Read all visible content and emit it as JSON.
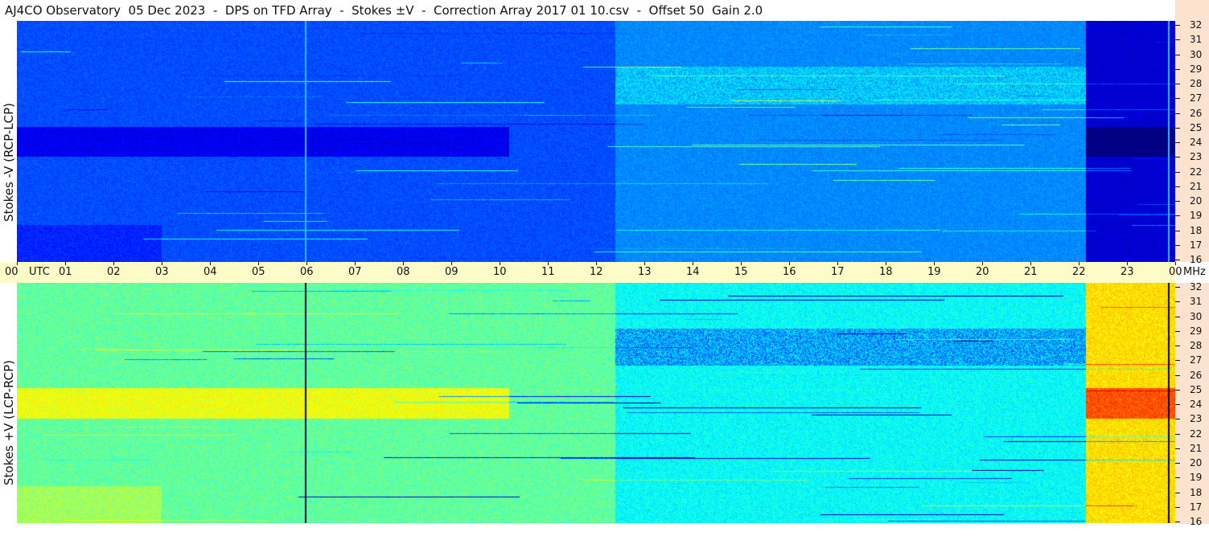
{
  "title": "AJ4CO Observatory  05 Dec 2023  -  DPS on TFD Array  -  Stokes ±V  -  Correction Array 2017 01 10.csv  -  Offset 50  Gain 2.0",
  "panels": {
    "top_label": "Stokes -V (RCP-LCP)",
    "bottom_label": "Stokes +V (LCP-RCP)"
  },
  "axis": {
    "utc_label": "UTC",
    "mhz_label": "MHz"
  },
  "chart_data": {
    "type": "heatmap",
    "title": "AJ4CO Observatory  05 Dec 2023  -  DPS on TFD Array  -  Stokes ±V  -  Correction Array 2017 01 10.csv  -  Offset 50  Gain 2.0",
    "x_unit": "UTC hour",
    "xlim": [
      0,
      24
    ],
    "x_ticks": [
      "00",
      "01",
      "02",
      "03",
      "04",
      "05",
      "06",
      "07",
      "08",
      "09",
      "10",
      "11",
      "12",
      "13",
      "14",
      "15",
      "16",
      "17",
      "18",
      "19",
      "20",
      "21",
      "22",
      "23",
      "00"
    ],
    "y_unit": "MHz",
    "ylim": [
      16,
      32
    ],
    "y_ticks": [
      32,
      31,
      30,
      29,
      28,
      27,
      26,
      25,
      24,
      23,
      22,
      21,
      20,
      19,
      18,
      17,
      16
    ],
    "panels": [
      {
        "name": "Stokes -V (RCP-LCP)",
        "position": "top",
        "colormap": "jet",
        "dominant": "dark blue"
      },
      {
        "name": "Stokes +V (LCP-RCP)",
        "position": "bottom",
        "colormap": "jet",
        "dominant": "light blue to green"
      }
    ],
    "colors": {
      "freq_axis_bg": "#fde3cf",
      "time_axis_bg": "#fdfbc8"
    }
  }
}
